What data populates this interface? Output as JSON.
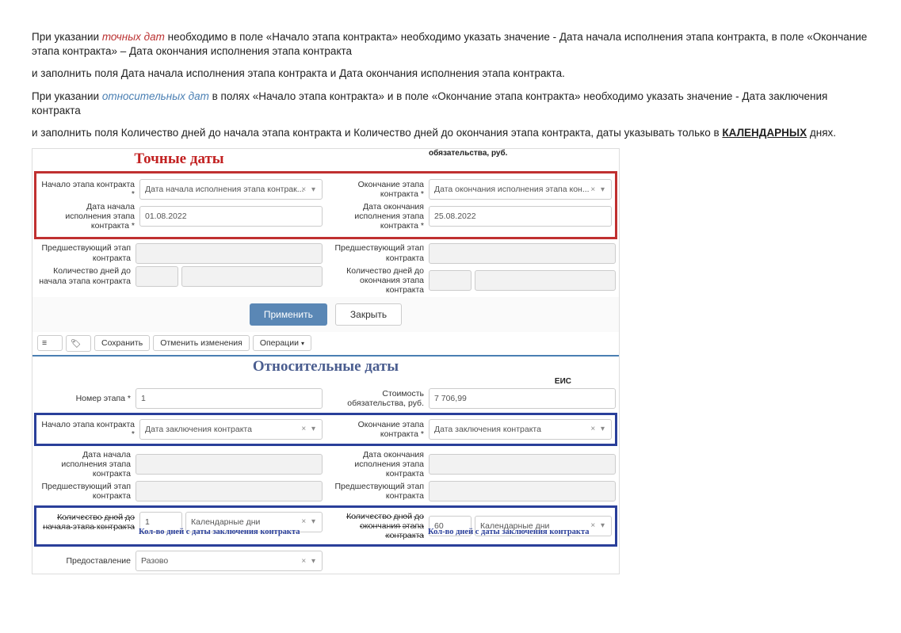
{
  "intro": {
    "p1_a": "При указании ",
    "exact_term": "точных дат",
    "p1_b": " необходимо в поле «Начало этапа контракта» необходимо указать значение - Дата начала исполнения этапа контракта, в поле «Окончание этапа контракта» – Дата окончания исполнения этапа контракта",
    "p2": "и заполнить поля Дата начала исполнения этапа контракта и Дата окончания исполнения этапа контракта.",
    "p3_a": "При указании ",
    "relative_term": "относительных дат",
    "p3_b": " в полях «Начало этапа контракта» и в поле «Окончание этапа контракта» необходимо указать значение - Дата заключения контракта",
    "p4_a": "и заполнить поля Количество дней до начала этапа контракта и Количество дней до окончания этапа контракта, даты указывать только в ",
    "calendar_days": "КАЛЕНДАРНЫХ",
    "p4_b": " днях."
  },
  "titles": {
    "exact": "Точные даты",
    "relative": "Относительные даты"
  },
  "labels": {
    "obligation_cost": "обязательства, руб.",
    "start_stage": "Начало этапа контракта *",
    "end_stage": "Окончание этапа контракта *",
    "start_date": "Дата начала исполнения этапа контракта *",
    "end_date": "Дата окончания исполнения этапа контракта *",
    "prev_stage": "Предшествующий этап контракта",
    "days_to_start": "Количество дней до начала этапа контракта",
    "days_to_end": "Количество дней до окончания этапа контракта",
    "stage_number": "Номер этапа *",
    "cost": "Стоимость обязательства, руб.",
    "provision": "Предоставление",
    "eis": "ЕИС",
    "start_date_short": "Дата начала исполнения этапа контракта",
    "end_date_short": "Дата окончания исполнения этапа контракта"
  },
  "values": {
    "start_exec_option": "Дата начала исполнения этапа контрак...",
    "end_exec_option": "Дата окончания исполнения этапа кон...",
    "contract_date_option": "Дата заключения контракта",
    "date_start": "01.08.2022",
    "date_end": "25.08.2022",
    "stage_number": "1",
    "cost": "7 706,99",
    "days_start": "1",
    "days_end": "60",
    "calendar_days": "Календарные дни",
    "razovo": "Разово"
  },
  "buttons": {
    "apply": "Применить",
    "close": "Закрыть",
    "save": "Сохранить",
    "cancel_changes": "Отменить изменения",
    "operations": "Операции",
    "menu": "≡",
    "tag": "🏷"
  },
  "notes": {
    "days_from_contract": "Кол-во дней с даты заключения контракта"
  }
}
